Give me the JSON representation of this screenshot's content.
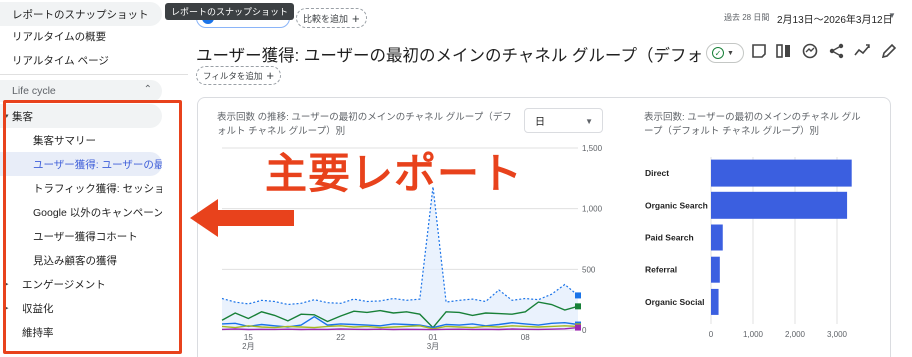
{
  "sidebar": {
    "top_items": [
      {
        "label": "レポートのスナップショット"
      },
      {
        "label": "リアルタイムの概要"
      },
      {
        "label": "リアルタイム ページ"
      }
    ],
    "section_label": "Life cycle",
    "nav": [
      {
        "label": "集客",
        "type": "group",
        "active": false
      },
      {
        "label": "集客サマリー",
        "type": "sub",
        "active": false
      },
      {
        "label": "ユーザー獲得: ユーザーの最...",
        "type": "sub",
        "active": true
      },
      {
        "label": "トラフィック獲得: セッション...",
        "type": "sub",
        "active": false
      },
      {
        "label": "Google 以外のキャンペーン",
        "type": "sub",
        "active": false
      },
      {
        "label": "ユーザー獲得コホート",
        "type": "sub",
        "active": false
      },
      {
        "label": "見込み顧客の獲得",
        "type": "sub",
        "active": false
      },
      {
        "label": "エンゲージメント",
        "type": "top",
        "active": false
      },
      {
        "label": "収益化",
        "type": "top",
        "active": false
      },
      {
        "label": "維持率",
        "type": "top",
        "active": false
      }
    ]
  },
  "tooltip": "レポートのスナップショット",
  "toolbar": {
    "compare_label": "比較を追加",
    "date_prefix": "過去 28 日間",
    "date_range": "2月13日〜2026年3月12日",
    "filter_label": "フィルタを追加"
  },
  "title": "ユーザー獲得: ユーザーの最初のメインのチャネル グループ（デフォルト チ...",
  "icons": [
    "save-icon",
    "compare-columns-icon",
    "insights-icon",
    "share-icon",
    "trend-icon",
    "edit-icon"
  ],
  "annotation": {
    "text": "主要レポート",
    "color": "#e8421c"
  },
  "line_card": {
    "title": "表示回数 の推移: ユーザーの最初のメインのチャネル グループ（デフォルト チャネル グループ）別",
    "granularity": "日"
  },
  "bar_card": {
    "title": "表示回数: ユーザーの最初のメインのチャネル グループ（デフォルト チャネル グループ）別"
  },
  "chart_data": [
    {
      "type": "line",
      "x": [
        "02-13",
        "02-14",
        "02-15",
        "02-16",
        "02-17",
        "02-18",
        "02-19",
        "02-20",
        "02-21",
        "02-22",
        "02-23",
        "02-24",
        "02-25",
        "02-26",
        "02-27",
        "02-28",
        "03-01",
        "03-02",
        "03-03",
        "03-04",
        "03-05",
        "03-06",
        "03-07",
        "03-08",
        "03-09",
        "03-10",
        "03-11",
        "03-12"
      ],
      "x_tick_labels": [
        {
          "day": "15",
          "month": "2月",
          "index": 2
        },
        {
          "day": "22",
          "month": "",
          "index": 9
        },
        {
          "day": "01",
          "month": "3月",
          "index": 16
        },
        {
          "day": "08",
          "month": "",
          "index": 23
        }
      ],
      "ylim": [
        0,
        1500
      ],
      "y_ticks": [
        "0",
        "500",
        "1,000",
        "1,500"
      ],
      "series": [
        {
          "color": "#1a73e8",
          "style": "dotted",
          "values": [
            260,
            230,
            215,
            245,
            235,
            210,
            220,
            250,
            225,
            220,
            255,
            235,
            240,
            260,
            245,
            255,
            1180,
            230,
            245,
            255,
            235,
            330,
            245,
            260,
            250,
            295,
            375,
            285
          ]
        },
        {
          "color": "#188038",
          "style": "solid",
          "values": [
            80,
            140,
            95,
            150,
            120,
            75,
            130,
            125,
            70,
            115,
            155,
            145,
            160,
            140,
            150,
            130,
            20,
            150,
            145,
            120,
            140,
            135,
            130,
            150,
            230,
            210,
            165,
            195
          ]
        },
        {
          "color": "#1a73e8",
          "style": "solid",
          "values": [
            50,
            55,
            30,
            45,
            35,
            25,
            40,
            110,
            40,
            50,
            45,
            40,
            35,
            50,
            45,
            40,
            20,
            45,
            40,
            50,
            35,
            45,
            60,
            50,
            40,
            55,
            60,
            45
          ]
        },
        {
          "color": "#a8b820",
          "style": "solid",
          "values": [
            30,
            20,
            35,
            25,
            20,
            30,
            25,
            20,
            30,
            35,
            25,
            30,
            20,
            25,
            30,
            35,
            10,
            30,
            25,
            20,
            30,
            25,
            35,
            30,
            25,
            30,
            35,
            30
          ]
        },
        {
          "color": "#9c27b0",
          "style": "solid",
          "values": [
            5,
            8,
            4,
            6,
            5,
            7,
            4,
            6,
            5,
            8,
            6,
            5,
            7,
            4,
            6,
            5,
            3,
            6,
            7,
            5,
            6,
            4,
            8,
            6,
            5,
            7,
            10,
            20
          ]
        }
      ]
    },
    {
      "type": "bar",
      "orientation": "horizontal",
      "categories": [
        "Direct",
        "Organic Search",
        "Paid Search",
        "Referral",
        "Organic Social"
      ],
      "values": [
        3350,
        3240,
        280,
        210,
        180
      ],
      "xlim": [
        0,
        3500
      ],
      "x_ticks": [
        "0",
        "1,000",
        "2,000",
        "3,000"
      ],
      "color": "#3b5fe0"
    }
  ]
}
